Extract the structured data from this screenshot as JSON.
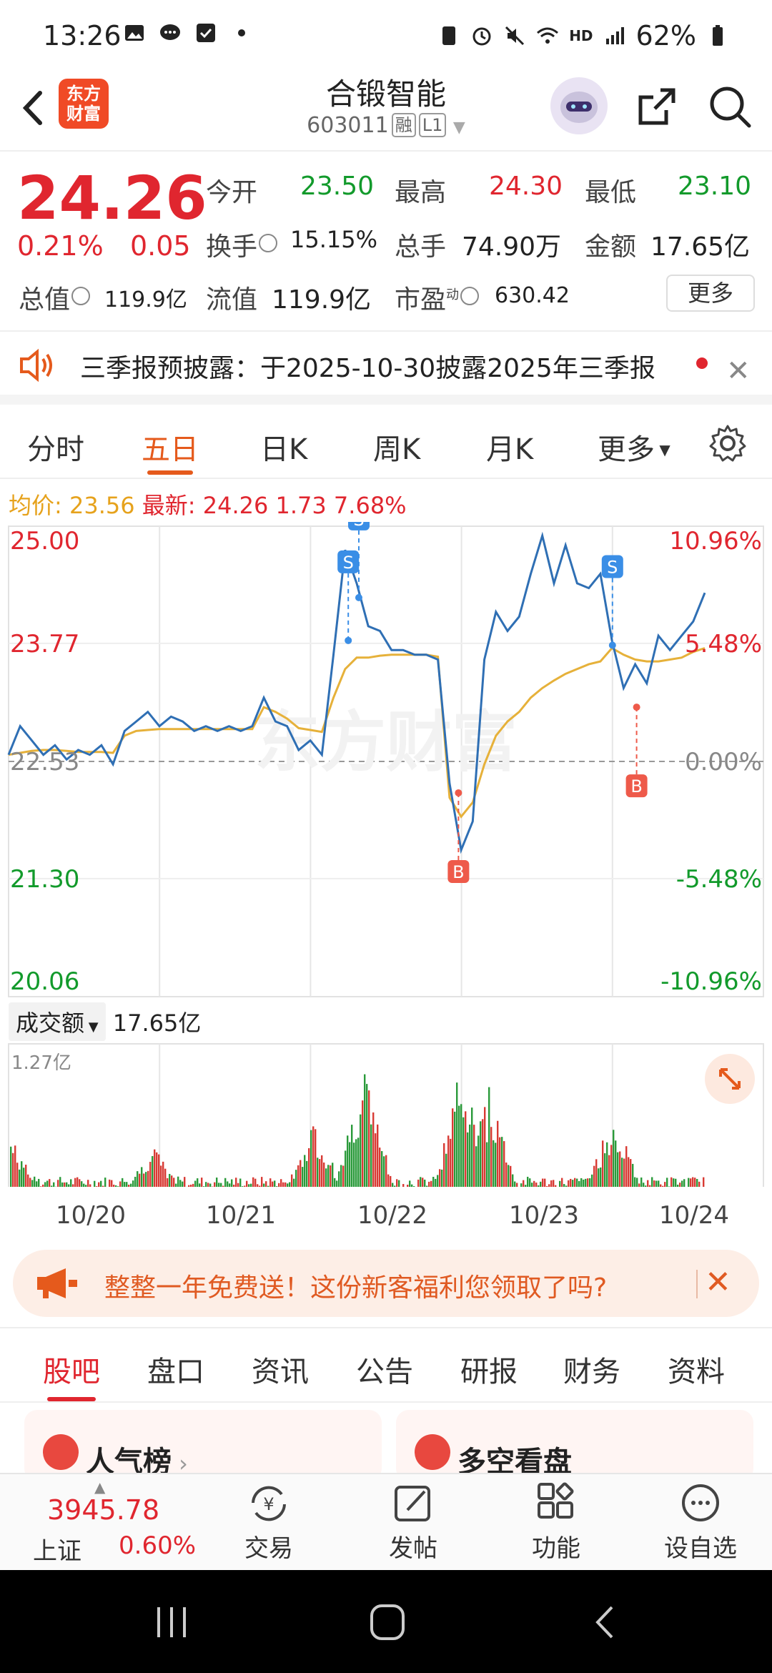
{
  "status_bar": {
    "time": "13:26",
    "battery": "62%"
  },
  "header": {
    "title": "合锻智能",
    "code": "603011",
    "tag_margin": "融",
    "tag_level": "L1",
    "logo_line1": "东方",
    "logo_line2": "财富"
  },
  "quote": {
    "price": "24.26",
    "change_pct": "0.21%",
    "change_abs": "0.05",
    "open_label": "今开",
    "open": "23.50",
    "high_label": "最高",
    "high": "24.30",
    "low_label": "最低",
    "low": "23.10",
    "turnover_label": "换手",
    "turnover": "15.15%",
    "volume_label": "总手",
    "volume": "74.90万",
    "amount_label": "金额",
    "amount": "17.65亿",
    "mktcap_label": "总值",
    "mktcap": "119.9亿",
    "float_label": "流值",
    "float": "119.9亿",
    "pe_label": "市盈",
    "pe_sup": "动",
    "pe": "630.42",
    "more_button": "更多"
  },
  "announcement": {
    "text": "三季报预披露：于2025-10-30披露2025年三季报"
  },
  "chart_tabs": [
    "分时",
    "五日",
    "日K",
    "周K",
    "月K",
    "更多"
  ],
  "info_line": {
    "avg_label": "均价:",
    "avg": "23.56",
    "latest_label": "最新:",
    "latest": "24.26",
    "chg": "1.73",
    "chg_pct": "7.68%"
  },
  "chart_data": {
    "type": "line",
    "x": [
      "10/20",
      "10/21",
      "10/22",
      "10/23",
      "10/24"
    ],
    "y_ticks_left": [
      "25.00",
      "23.77",
      "22.53",
      "21.30",
      "20.06"
    ],
    "y_ticks_right": [
      "10.96%",
      "5.48%",
      "0.00%",
      "-5.48%",
      "-10.96%"
    ],
    "ylim": [
      20.06,
      25.0
    ],
    "prev_close": 22.53,
    "watermark": "东方财富",
    "series": [
      {
        "values": [
          22.6,
          22.9,
          22.75,
          22.6,
          22.7,
          22.55,
          22.65,
          22.6,
          22.7,
          22.5,
          22.85,
          22.95,
          23.05,
          22.9,
          23.0,
          22.95,
          22.85,
          22.9,
          22.85,
          22.9,
          22.85,
          22.9,
          23.2,
          22.95,
          22.9,
          22.65,
          22.75,
          22.6,
          23.65,
          24.75,
          24.4,
          23.95,
          23.9,
          23.7,
          23.7,
          23.65,
          23.65,
          23.6,
          22.3,
          21.6,
          21.9,
          23.6,
          24.1,
          23.9,
          24.05,
          24.5,
          24.9,
          24.4,
          24.8,
          24.4,
          24.35,
          24.5,
          23.8,
          23.3,
          23.55,
          23.35,
          23.85,
          23.7,
          23.85,
          24.0,
          24.3
        ]
      },
      {
        "values": [
          22.6,
          22.62,
          22.64,
          22.65,
          22.65,
          22.64,
          22.63,
          22.63,
          22.63,
          22.62,
          22.8,
          22.85,
          22.86,
          22.87,
          22.87,
          22.87,
          22.87,
          22.87,
          22.87,
          22.87,
          22.87,
          22.87,
          23.1,
          23.05,
          22.98,
          22.88,
          22.86,
          22.84,
          23.2,
          23.5,
          23.62,
          23.62,
          23.64,
          23.65,
          23.65,
          23.65,
          23.65,
          23.63,
          22.15,
          21.95,
          22.1,
          22.5,
          22.8,
          22.95,
          23.05,
          23.2,
          23.3,
          23.38,
          23.45,
          23.5,
          23.55,
          23.58,
          23.72,
          23.65,
          23.6,
          23.58,
          23.58,
          23.6,
          23.62,
          23.68,
          23.72
        ]
      }
    ],
    "markers": [
      {
        "label": "S",
        "x": 2.25,
        "y": 23.8
      },
      {
        "label": "S",
        "x": 2.32,
        "y": 24.25
      },
      {
        "label": "B",
        "x": 2.98,
        "y": 22.2
      },
      {
        "label": "S",
        "x": 4.0,
        "y": 23.75
      },
      {
        "label": "B",
        "x": 4.16,
        "y": 23.1
      }
    ]
  },
  "volume": {
    "selector": "成交额",
    "total": "17.65亿",
    "max_label": "1.27亿"
  },
  "promo": {
    "text": "整整一年免费送！这份新客福利您领取了吗?"
  },
  "bottom_tabs": [
    "股吧",
    "盘口",
    "资讯",
    "公告",
    "研报",
    "财务",
    "资料"
  ],
  "cards": {
    "left": "人气榜",
    "right": "多空看盘"
  },
  "bottom_nav": {
    "index_value": "3945.78",
    "index_name": "上证",
    "index_pct": "0.60%",
    "trade": "交易",
    "post": "发帖",
    "function": "功能",
    "watchlist": "设自选"
  },
  "colors": {
    "up": "#e0262f",
    "down": "#129a2b",
    "accent": "#e55a1c",
    "price_line": "#2f6fb4",
    "avg_line": "#e6b13a"
  }
}
